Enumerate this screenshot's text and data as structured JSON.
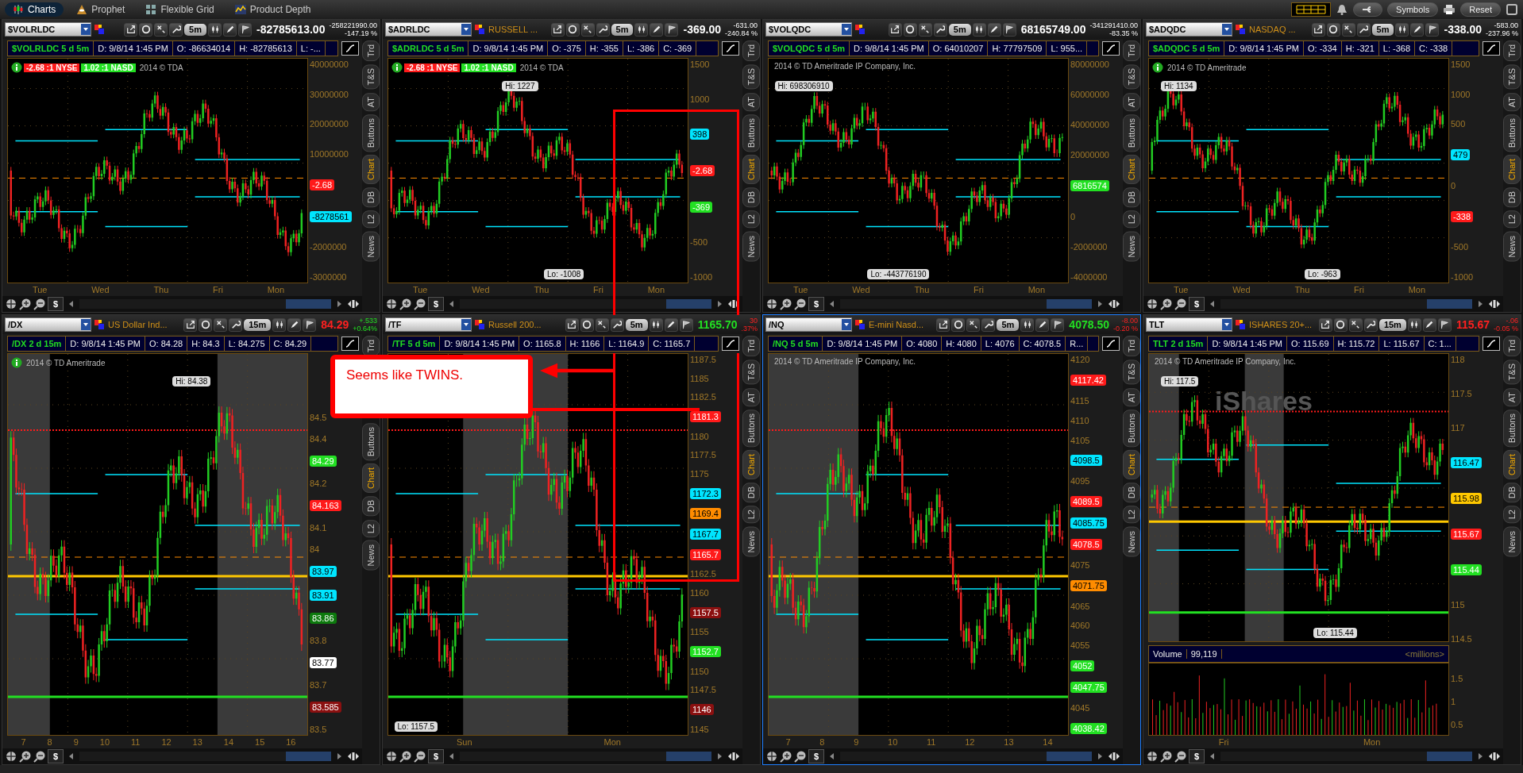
{
  "top_bar": {
    "tabs": [
      {
        "label": "Charts",
        "selected": true
      },
      {
        "label": "Prophet",
        "selected": false
      },
      {
        "label": "Flexible Grid",
        "selected": false
      },
      {
        "label": "Product Depth",
        "selected": false
      }
    ],
    "buttons": [
      "Symbols",
      "Reset"
    ]
  },
  "panels": [
    {
      "symbol": "$VOLRLDC",
      "interval": "5m",
      "price": "-82785613.00",
      "change": "-258221990.00",
      "change_pct": "-147.19 %",
      "active": false,
      "info_title": "$VOLRLDC 5 d 5m",
      "info_fields": [
        "D: 9/8/14 1:45 PM",
        "O: -86634014",
        "H: -82785613",
        "L: -..."
      ],
      "ratio_badges": [
        {
          "text": "-2.68 :1 NYSE",
          "color": "#ff1a1a"
        },
        {
          "text": "1.02 :1 NASD",
          "color": "#22e022"
        }
      ],
      "copyright": "2014 © TDA",
      "info_icon": true,
      "axis": [
        {
          "kind": "tick",
          "text": "40000000"
        },
        {
          "kind": "tick",
          "text": "30000000"
        },
        {
          "kind": "tick",
          "text": "20000000"
        },
        {
          "kind": "tick",
          "text": "10000000"
        },
        {
          "kind": "tag",
          "text": "-2.68",
          "color": "#ff1a1a"
        },
        {
          "kind": "tag",
          "text": "-8278561",
          "color": "#00e5ff"
        },
        {
          "kind": "tick",
          "text": "-2000000"
        },
        {
          "kind": "tick",
          "text": "-3000000"
        }
      ],
      "xlabels": [
        "Tue",
        "Wed",
        "Thu",
        "Fri",
        "Mon"
      ],
      "side_tabs": [
        {
          "label": "Trd",
          "selected": false
        },
        {
          "label": "T&S",
          "selected": false
        },
        {
          "label": "AT",
          "selected": false
        },
        {
          "label": "Buttons",
          "selected": false
        },
        {
          "label": "Chart",
          "selected": true
        },
        {
          "label": "DB",
          "selected": false
        },
        {
          "label": "L2",
          "selected": false
        },
        {
          "label": "News",
          "selected": false
        }
      ],
      "dollar": "$"
    },
    {
      "symbol": "$ADRLDC",
      "description": "RUSSELL ...",
      "interval": "5m",
      "price": "-369.00",
      "change": "-631.00",
      "change_pct": "-240.84 %",
      "active": false,
      "info_title": "$ADRLDC 5 d 5m",
      "info_fields": [
        "D: 9/8/14 1:45 PM",
        "O: -375",
        "H: -355",
        "L: -386",
        "C: -369"
      ],
      "ratio_badges": [
        {
          "text": "-2.68 :1 NYSE",
          "color": "#ff1a1a"
        },
        {
          "text": "1.02 :1 NASD",
          "color": "#22e022"
        }
      ],
      "copyright": "2014 © TDA",
      "info_icon": true,
      "hi": "Hi: 1227",
      "lo": "Lo: -1008",
      "axis": [
        {
          "kind": "tick",
          "text": "1500"
        },
        {
          "kind": "tick",
          "text": "1000"
        },
        {
          "kind": "tag",
          "text": "398",
          "color": "#00e5ff"
        },
        {
          "kind": "tag",
          "text": "-2.68",
          "color": "#ff1a1a"
        },
        {
          "kind": "tag",
          "text": "-369",
          "color": "#22e022"
        },
        {
          "kind": "tick",
          "text": "-500"
        },
        {
          "kind": "tick",
          "text": "-1000"
        }
      ],
      "xlabels": [
        "Tue",
        "Wed",
        "Thu",
        "Fri",
        "Mon"
      ],
      "side_tabs": [
        {
          "label": "Trd",
          "selected": false
        },
        {
          "label": "T&S",
          "selected": false
        },
        {
          "label": "AT",
          "selected": false
        },
        {
          "label": "Buttons",
          "selected": false
        },
        {
          "label": "Chart",
          "selected": true
        },
        {
          "label": "DB",
          "selected": false
        },
        {
          "label": "L2",
          "selected": false
        },
        {
          "label": "News",
          "selected": false
        }
      ],
      "dollar": "$"
    },
    {
      "symbol": "$VOLQDC",
      "interval": "5m",
      "price": "68165749.00",
      "change": "-341291410.00",
      "change_pct": "-83.35 %",
      "active": false,
      "info_title": "$VOLQDC 5 d 5m",
      "info_fields": [
        "D: 9/8/14 1:45 PM",
        "O: 64010207",
        "H: 77797509",
        "L: 955..."
      ],
      "copyright": "2014 © TD Ameritrade IP Company, Inc.",
      "info_icon": false,
      "hi": "Hi: 698306910",
      "lo": "Lo: -443776190",
      "axis": [
        {
          "kind": "tick",
          "text": "80000000"
        },
        {
          "kind": "tick",
          "text": "60000000"
        },
        {
          "kind": "tick",
          "text": "40000000"
        },
        {
          "kind": "tick",
          "text": "20000000"
        },
        {
          "kind": "tag",
          "text": "6816574",
          "color": "#22e022"
        },
        {
          "kind": "tick",
          "text": "0"
        },
        {
          "kind": "tick",
          "text": "-2000000"
        },
        {
          "kind": "tick",
          "text": "-4000000"
        }
      ],
      "xlabels": [
        "Tue",
        "Wed",
        "Thu",
        "Fri",
        "Mon"
      ],
      "side_tabs": [
        {
          "label": "Trd",
          "selected": false
        },
        {
          "label": "T&S",
          "selected": false
        },
        {
          "label": "AT",
          "selected": false
        },
        {
          "label": "Buttons",
          "selected": false
        },
        {
          "label": "Chart",
          "selected": true
        },
        {
          "label": "DB",
          "selected": false
        },
        {
          "label": "L2",
          "selected": false
        },
        {
          "label": "News",
          "selected": false
        }
      ],
      "dollar": "$"
    },
    {
      "symbol": "$ADQDC",
      "description": "NASDAQ ...",
      "interval": "5m",
      "price": "-338.00",
      "change": "-583.00",
      "change_pct": "-237.96 %",
      "active": false,
      "info_title": "$ADQDC 5 d 5m",
      "info_fields": [
        "D: 9/8/14 1:45 PM",
        "O: -334",
        "H: -321",
        "L: -368",
        "C: -338"
      ],
      "copyright": "2014 © TD Ameritrade",
      "info_icon": true,
      "hi": "Hi: 1134",
      "lo": "Lo: -963",
      "axis": [
        {
          "kind": "tick",
          "text": "1500"
        },
        {
          "kind": "tick",
          "text": "1000"
        },
        {
          "kind": "tick",
          "text": "500"
        },
        {
          "kind": "tag",
          "text": "479",
          "color": "#00e5ff"
        },
        {
          "kind": "tick",
          "text": "0"
        },
        {
          "kind": "tag",
          "text": "-338",
          "color": "#ff1a1a"
        },
        {
          "kind": "tick",
          "text": "-500"
        },
        {
          "kind": "tick",
          "text": "-1000"
        }
      ],
      "xlabels": [
        "Tue",
        "Wed",
        "Thu",
        "Fri",
        "Mon"
      ],
      "side_tabs": [
        {
          "label": "Trd",
          "selected": false
        },
        {
          "label": "T&S",
          "selected": false
        },
        {
          "label": "AT",
          "selected": false
        },
        {
          "label": "Buttons",
          "selected": false
        },
        {
          "label": "Chart",
          "selected": true
        },
        {
          "label": "DB",
          "selected": false
        },
        {
          "label": "L2",
          "selected": false
        },
        {
          "label": "News",
          "selected": false
        }
      ],
      "dollar": "$"
    },
    {
      "symbol": "/DX",
      "description": "US Dollar Ind...",
      "interval": "15m",
      "price": "84.29",
      "price_down": true,
      "change": "+.533",
      "change_pct": "+0.64%",
      "change_down": false,
      "active": false,
      "info_title": "/DX 2 d 15m",
      "info_fields": [
        "D: 9/8/14 1:45 PM",
        "O: 84.28",
        "H: 84.3",
        "L: 84.275",
        "C: 84.29"
      ],
      "copyright": "2014 © TD Ameritrade",
      "info_icon": true,
      "hi": "Hi: 84.38",
      "axis": [
        {
          "kind": "tick",
          "text": "84.5"
        },
        {
          "kind": "tick",
          "text": "84.4"
        },
        {
          "kind": "tag",
          "text": "84.29",
          "color": "#22e022"
        },
        {
          "kind": "tick",
          "text": "84.2"
        },
        {
          "kind": "tag",
          "text": "84.163",
          "color": "#ff1a1a"
        },
        {
          "kind": "tick",
          "text": "84.1"
        },
        {
          "kind": "tick",
          "text": "84"
        },
        {
          "kind": "tag",
          "text": "83.97",
          "color": "#00e5ff"
        },
        {
          "kind": "tag",
          "text": "83.91",
          "color": "#00e5ff"
        },
        {
          "kind": "tag",
          "text": "83.86",
          "color": "#0d7a0d"
        },
        {
          "kind": "tick",
          "text": "83.8"
        },
        {
          "kind": "tag",
          "text": "83.77",
          "color": "#ffffff"
        },
        {
          "kind": "tick",
          "text": "83.7"
        },
        {
          "kind": "tag",
          "text": "83.585",
          "color": "#8b1010"
        },
        {
          "kind": "tick",
          "text": "83.5"
        }
      ],
      "xlabels": [
        "7",
        "8",
        "9",
        "10",
        "11",
        "12",
        "13",
        "14",
        "15",
        "16"
      ],
      "side_tabs": [
        {
          "label": "Trd",
          "selected": false
        },
        {
          "label": "Buttons",
          "selected": false
        },
        {
          "label": "Chart",
          "selected": true
        },
        {
          "label": "DB",
          "selected": false
        },
        {
          "label": "L2",
          "selected": false
        },
        {
          "label": "News",
          "selected": false
        }
      ],
      "dollar": "$"
    },
    {
      "symbol": "/TF",
      "description": "Russell 200...",
      "interval": "5m",
      "price": "1165.70",
      "price_down": false,
      "change": "30",
      "change_pct": ".37%",
      "change_down": true,
      "active": false,
      "info_title": "/TF 5 d 5m",
      "info_fields": [
        "D: 9/8/14 1:45 PM",
        "O: 1165.8",
        "H: 1166",
        "L: 1164.9",
        "C: 1165.7"
      ],
      "info_icon": false,
      "lo": "Lo: 1157.5",
      "axis": [
        {
          "kind": "tick",
          "text": "1187.5"
        },
        {
          "kind": "tick",
          "text": "1185"
        },
        {
          "kind": "tick",
          "text": "1182.5"
        },
        {
          "kind": "tag",
          "text": "1181.3",
          "color": "#ff1a1a"
        },
        {
          "kind": "tick",
          "text": "1180"
        },
        {
          "kind": "tick",
          "text": "1177.5"
        },
        {
          "kind": "tick",
          "text": "1175"
        },
        {
          "kind": "tag",
          "text": "1172.3",
          "color": "#00e5ff"
        },
        {
          "kind": "tag",
          "text": "1169.4",
          "color": "#ff8c00"
        },
        {
          "kind": "tag",
          "text": "1167.7",
          "color": "#00e5ff"
        },
        {
          "kind": "tag",
          "text": "1165.7",
          "color": "#ff1a1a"
        },
        {
          "kind": "tick",
          "text": "1162.5"
        },
        {
          "kind": "tick",
          "text": "1160"
        },
        {
          "kind": "tag",
          "text": "1157.5",
          "color": "#8b1010"
        },
        {
          "kind": "tick",
          "text": "1155"
        },
        {
          "kind": "tag",
          "text": "1152.7",
          "color": "#22e022"
        },
        {
          "kind": "tick",
          "text": "1150"
        },
        {
          "kind": "tick",
          "text": "1147.5"
        },
        {
          "kind": "tag",
          "text": "1146",
          "color": "#8b1010"
        },
        {
          "kind": "tick",
          "text": "1145"
        }
      ],
      "xlabels": [
        "Sun",
        "Mon"
      ],
      "side_tabs": [
        {
          "label": "Trd",
          "selected": false
        },
        {
          "label": "T&S",
          "selected": false
        },
        {
          "label": "AT",
          "selected": false
        },
        {
          "label": "Buttons",
          "selected": false
        },
        {
          "label": "Chart",
          "selected": true
        },
        {
          "label": "DB",
          "selected": false
        },
        {
          "label": "L2",
          "selected": false
        },
        {
          "label": "News",
          "selected": false
        }
      ],
      "dollar": "$"
    },
    {
      "symbol": "/NQ",
      "description": "E-mini Nasd...",
      "interval": "5m",
      "price": "4078.50",
      "price_down": false,
      "change": "-8.00",
      "change_pct": "-0.20 %",
      "change_down": true,
      "active": true,
      "info_title": "/NQ 5 d 5m",
      "info_fields": [
        "D: 9/8/14 1:45 PM",
        "O: 4080",
        "H: 4080",
        "L: 4076",
        "C: 4078.5",
        "R..."
      ],
      "copyright": "2014 © TD Ameritrade IP Company, Inc.",
      "info_icon": false,
      "axis": [
        {
          "kind": "tick",
          "text": "4120"
        },
        {
          "kind": "tag",
          "text": "4117.42",
          "color": "#ff1a1a"
        },
        {
          "kind": "tick",
          "text": "4115"
        },
        {
          "kind": "tick",
          "text": "4110"
        },
        {
          "kind": "tick",
          "text": "4105"
        },
        {
          "kind": "tag",
          "text": "4098.5",
          "color": "#00e5ff"
        },
        {
          "kind": "tick",
          "text": "4095"
        },
        {
          "kind": "tag",
          "text": "4089.5",
          "color": "#ff1a1a"
        },
        {
          "kind": "tag",
          "text": "4085.75",
          "color": "#00e5ff"
        },
        {
          "kind": "tag",
          "text": "4078.5",
          "color": "#ff1a1a"
        },
        {
          "kind": "tick",
          "text": "4075"
        },
        {
          "kind": "tag",
          "text": "4071.75",
          "color": "#ff8c00"
        },
        {
          "kind": "tick",
          "text": "4065"
        },
        {
          "kind": "tick",
          "text": "4060"
        },
        {
          "kind": "tick",
          "text": "4055"
        },
        {
          "kind": "tag",
          "text": "4052",
          "color": "#22e022"
        },
        {
          "kind": "tag",
          "text": "4047.75",
          "color": "#22e022"
        },
        {
          "kind": "tick",
          "text": "4045"
        },
        {
          "kind": "tag",
          "text": "4038.42",
          "color": "#22e022"
        }
      ],
      "xlabels": [
        "7",
        "8",
        "9",
        "10",
        "11",
        "12",
        "13",
        "14"
      ],
      "side_tabs": [
        {
          "label": "Trd",
          "selected": false
        },
        {
          "label": "T&S",
          "selected": false
        },
        {
          "label": "AT",
          "selected": false
        },
        {
          "label": "Buttons",
          "selected": false
        },
        {
          "label": "Chart",
          "selected": true
        },
        {
          "label": "DB",
          "selected": false
        },
        {
          "label": "L2",
          "selected": false
        },
        {
          "label": "News",
          "selected": false
        }
      ],
      "dollar": "$"
    },
    {
      "symbol": "TLT",
      "description": "ISHARES 20+...",
      "interval": "15m",
      "price": "115.67",
      "price_down": true,
      "change": "-.06",
      "change_pct": "-0.05 %",
      "change_down": true,
      "active": false,
      "info_title": "TLT 2 d 15m",
      "info_fields": [
        "D: 9/8/14 1:45 PM",
        "O: 115.69",
        "H: 115.72",
        "L: 115.67",
        "C: 1..."
      ],
      "copyright": "2014 © TD Ameritrade IP Company, Inc.",
      "info_icon": false,
      "logo": "iShares",
      "hi": "Hi: 117.5",
      "lo": "Lo: 115.44",
      "axis": [
        {
          "kind": "tick",
          "text": "118"
        },
        {
          "kind": "tick",
          "text": "117.5"
        },
        {
          "kind": "tick",
          "text": "117"
        },
        {
          "kind": "tag",
          "text": "116.47",
          "color": "#00e5ff"
        },
        {
          "kind": "tag",
          "text": "115.98",
          "color": "#ffc800"
        },
        {
          "kind": "tag",
          "text": "115.67",
          "color": "#ff1a1a"
        },
        {
          "kind": "tag",
          "text": "115.44",
          "color": "#22e022"
        },
        {
          "kind": "tick",
          "text": "115"
        },
        {
          "kind": "tick",
          "text": "114.5"
        }
      ],
      "volume": {
        "label": "Volume",
        "value": "99,119",
        "unit": "<millions>",
        "ticks": [
          "1.5",
          "1",
          "0.5"
        ]
      },
      "xlabels": [
        "Fri",
        "Mon"
      ],
      "side_tabs": [
        {
          "label": "Trd",
          "selected": false
        },
        {
          "label": "T&S",
          "selected": false
        },
        {
          "label": "AT",
          "selected": false
        },
        {
          "label": "Buttons",
          "selected": false
        },
        {
          "label": "Chart",
          "selected": true
        },
        {
          "label": "DB",
          "selected": false
        },
        {
          "label": "L2",
          "selected": false
        },
        {
          "label": "News",
          "selected": false
        }
      ],
      "dollar": "$"
    }
  ],
  "annotation": {
    "text": "Seems like TWINS."
  }
}
